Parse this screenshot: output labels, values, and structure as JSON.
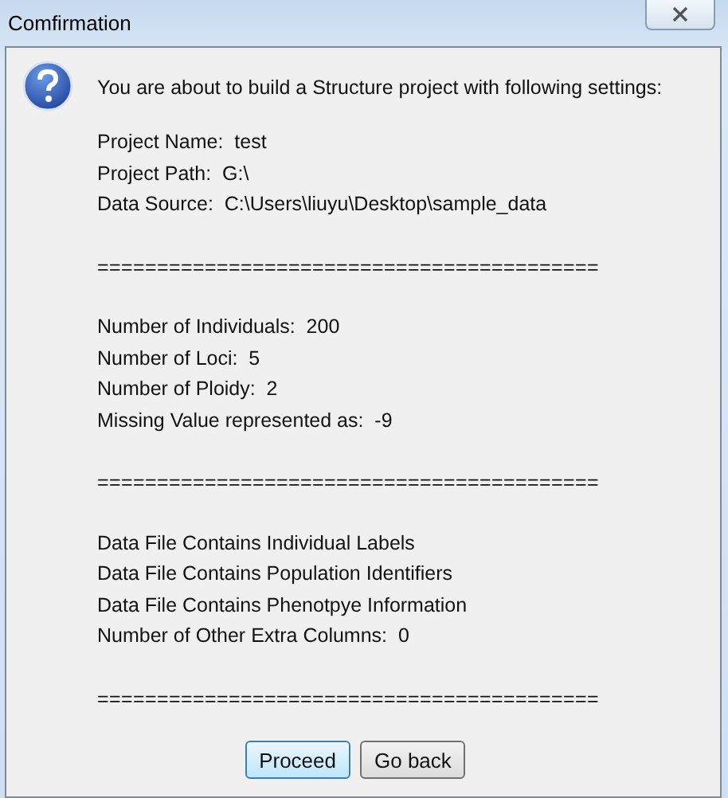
{
  "window": {
    "title": "Comfirmation"
  },
  "message": "You are about to build a Structure project with following settings:",
  "groups": [
    {
      "lines": [
        "Project Name:  test",
        "Project Path:  G:\\",
        "Data Source:  C:\\Users\\liuyu\\Desktop\\sample_data"
      ],
      "separator": "=========================================="
    },
    {
      "lines": [
        "Number of Individuals:  200",
        "Number of Loci:  5",
        "Number of Ploidy:  2",
        "Missing Value represented as:  -9"
      ],
      "separator": "=========================================="
    },
    {
      "lines": [
        "Data File Contains Individual Labels",
        "Data File Contains Population Identifiers",
        "Data File Contains Phenotpye Information",
        "Number of Other Extra Columns:  0"
      ],
      "separator": "=========================================="
    }
  ],
  "buttons": [
    {
      "label": "Proceed",
      "selected": true
    },
    {
      "label": "Go back",
      "selected": false
    }
  ]
}
